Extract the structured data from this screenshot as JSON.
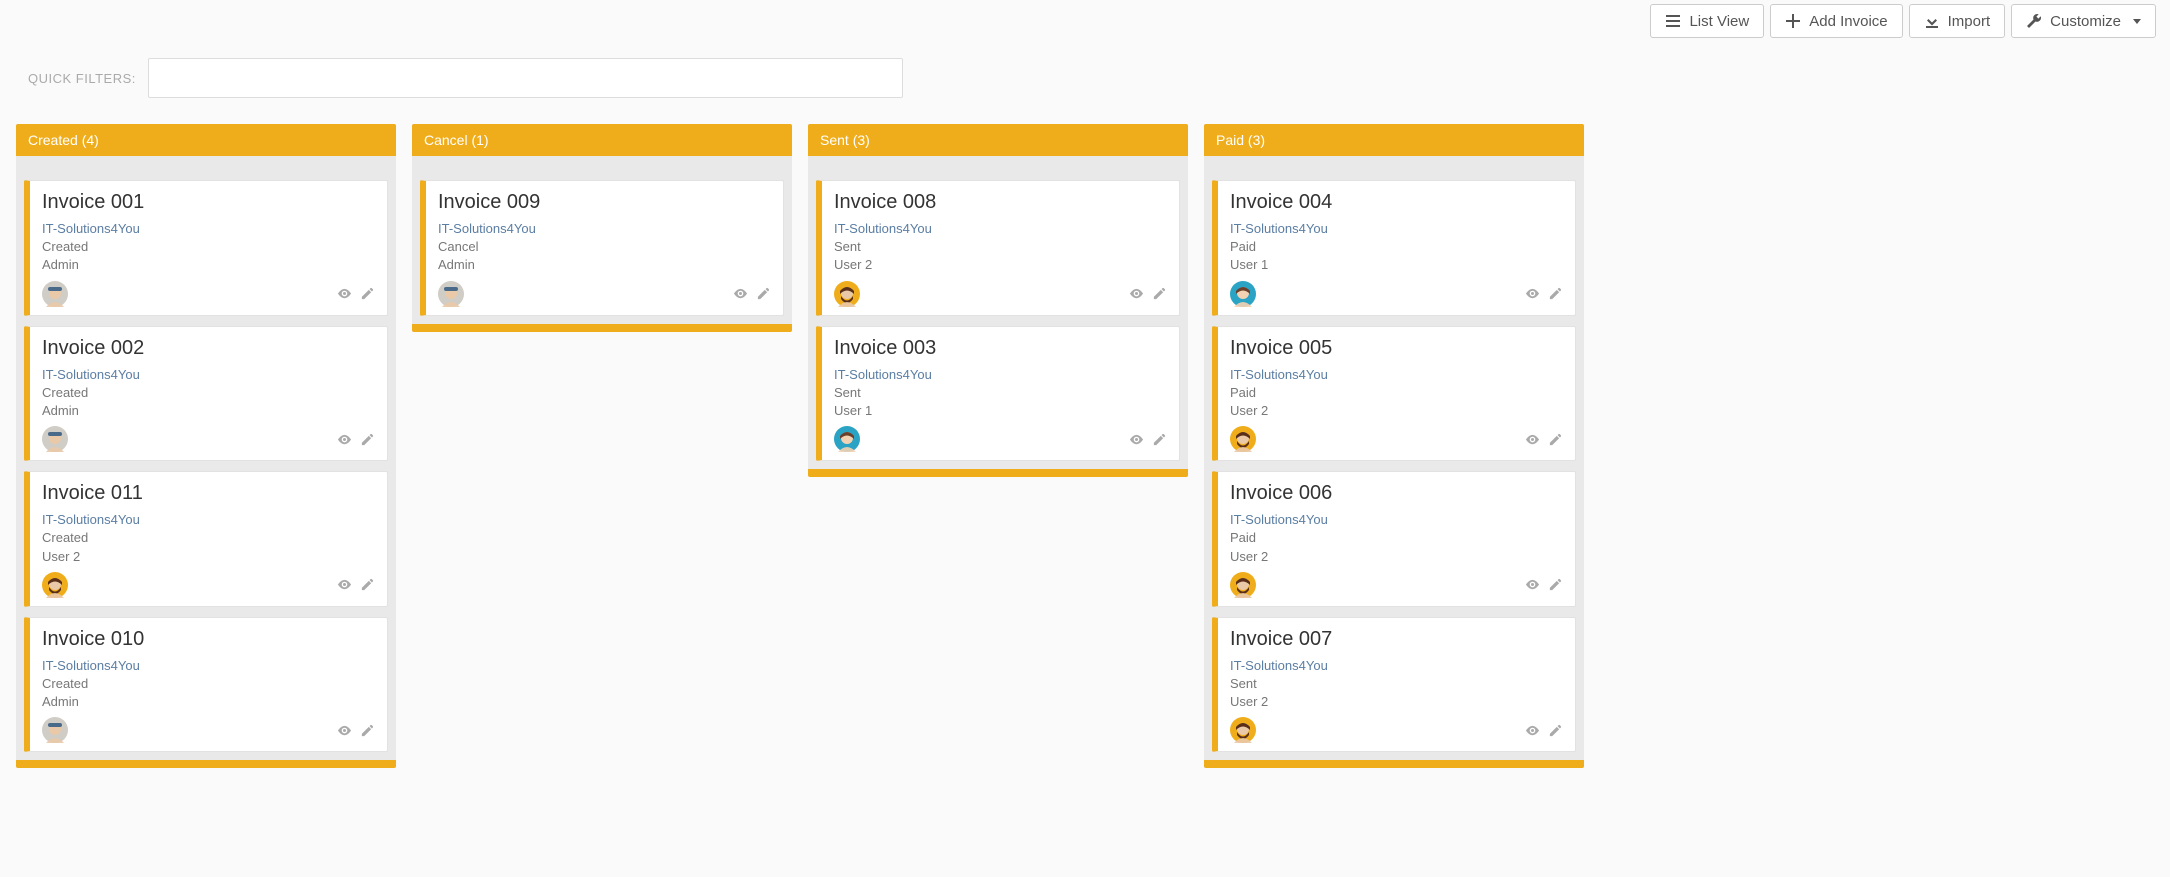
{
  "toolbar": {
    "list_view": "List View",
    "add_invoice": "Add Invoice",
    "import": "Import",
    "customize": "Customize"
  },
  "filters": {
    "label": "QUICK FILTERS:",
    "value": ""
  },
  "avatars": {
    "admin": {
      "bg": "#d0ccc6",
      "face": "#e9c9a8",
      "hat": "#4a6a8a",
      "hair": "none"
    },
    "user1": {
      "bg": "#2aa3c4",
      "face": "#f3d2b3",
      "hair": "#6b3f2a"
    },
    "user2": {
      "bg": "#f0ad1b",
      "face": "#e9c9a8",
      "hair": "#5a2f1a",
      "beard": true
    }
  },
  "columns": [
    {
      "title": "Created",
      "count": 4,
      "cards": [
        {
          "title": "Invoice 001",
          "org": "IT-Solutions4You",
          "status": "Created",
          "user": "Admin",
          "avatar": "admin"
        },
        {
          "title": "Invoice 002",
          "org": "IT-Solutions4You",
          "status": "Created",
          "user": "Admin",
          "avatar": "admin"
        },
        {
          "title": "Invoice 011",
          "org": "IT-Solutions4You",
          "status": "Created",
          "user": "User 2",
          "avatar": "user2"
        },
        {
          "title": "Invoice 010",
          "org": "IT-Solutions4You",
          "status": "Created",
          "user": "Admin",
          "avatar": "admin"
        }
      ]
    },
    {
      "title": "Cancel",
      "count": 1,
      "cards": [
        {
          "title": "Invoice 009",
          "org": "IT-Solutions4You",
          "status": "Cancel",
          "user": "Admin",
          "avatar": "admin"
        }
      ]
    },
    {
      "title": "Sent",
      "count": 3,
      "cards": [
        {
          "title": "Invoice 008",
          "org": "IT-Solutions4You",
          "status": "Sent",
          "user": "User 2",
          "avatar": "user2"
        },
        {
          "title": "Invoice 003",
          "org": "IT-Solutions4You",
          "status": "Sent",
          "user": "User 1",
          "avatar": "user1"
        }
      ]
    },
    {
      "title": "Paid",
      "count": 3,
      "cards": [
        {
          "title": "Invoice 004",
          "org": "IT-Solutions4You",
          "status": "Paid",
          "user": "User 1",
          "avatar": "user1"
        },
        {
          "title": "Invoice 005",
          "org": "IT-Solutions4You",
          "status": "Paid",
          "user": "User 2",
          "avatar": "user2"
        },
        {
          "title": "Invoice 006",
          "org": "IT-Solutions4You",
          "status": "Paid",
          "user": "User 2",
          "avatar": "user2"
        },
        {
          "title": "Invoice 007",
          "org": "IT-Solutions4You",
          "status": "Sent",
          "user": "User 2",
          "avatar": "user2"
        }
      ]
    }
  ]
}
